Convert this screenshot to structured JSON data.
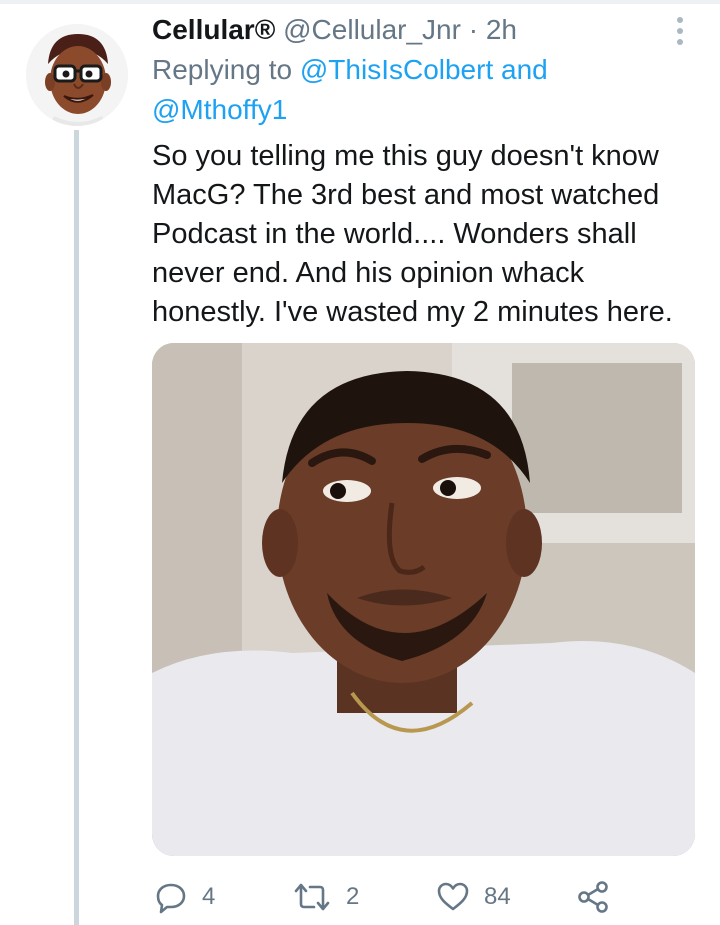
{
  "tweet": {
    "display_name": "Cellular®",
    "handle": "@Cellular_Jnr",
    "separator": "·",
    "timestamp": "2h",
    "reply_prefix": "Replying to",
    "reply_mention_1": "@ThisIsColbert",
    "reply_conjunction": "and",
    "reply_mention_2": "@Mthoffy1",
    "text": "So you telling me this guy doesn't know MacG? The 3rd best and most watched Podcast in the world.... Wonders shall never end. And his opinion whack honestly. I've wasted my 2 minutes here."
  },
  "actions": {
    "reply_count": "4",
    "retweet_count": "2",
    "like_count": "84"
  },
  "icons": {
    "more": "more-vertical-icon",
    "reply": "reply-icon",
    "retweet": "retweet-icon",
    "like": "heart-icon",
    "share": "share-icon"
  },
  "colors": {
    "link": "#1da1f2",
    "muted": "#657786",
    "text": "#14171a",
    "thread_line": "#ccd6dd"
  }
}
